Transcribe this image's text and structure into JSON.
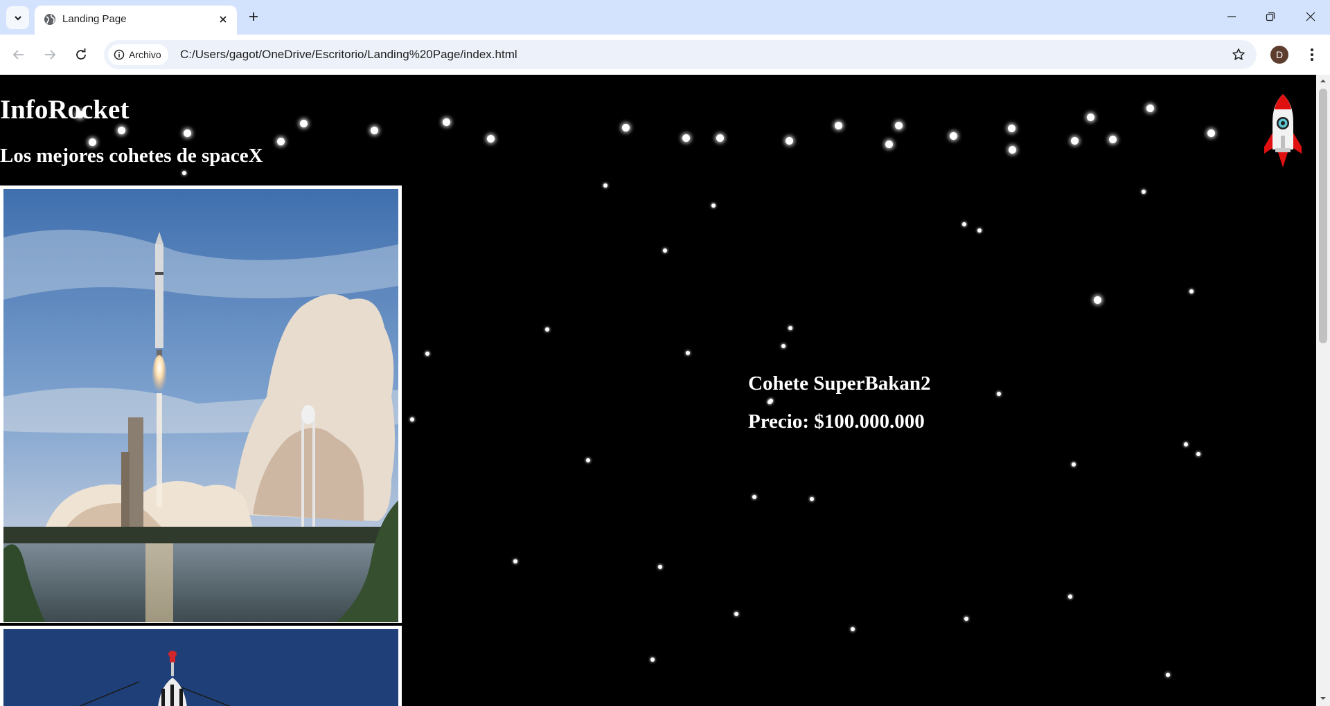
{
  "browser": {
    "tab_title": "Landing Page",
    "site_chip_label": "Archivo",
    "url": "C:/Users/gagot/OneDrive/Escritorio/Landing%20Page/index.html",
    "profile_initial": "D",
    "icons": [
      "tab-search-chevron",
      "globe",
      "close",
      "plus",
      "minimize",
      "restore",
      "close-window",
      "back-arrow",
      "forward-arrow",
      "reload",
      "info",
      "star",
      "kebab-menu"
    ]
  },
  "page": {
    "title": "InfoRocket",
    "subtitle": "Los mejores cohetes de spaceX",
    "product_name": "Cohete SuperBakan2",
    "product_price": "Precio: $100.000.000",
    "background_color": "#000000",
    "images": [
      "rocket-launch-photo",
      "rocket-nose-photo"
    ],
    "logo": "rocket-logo"
  },
  "colors": {
    "tabstrip": "#d3e3fd",
    "omnibox": "#edf2fa",
    "page_text": "#ffffff",
    "rocket_red": "#e01010"
  }
}
